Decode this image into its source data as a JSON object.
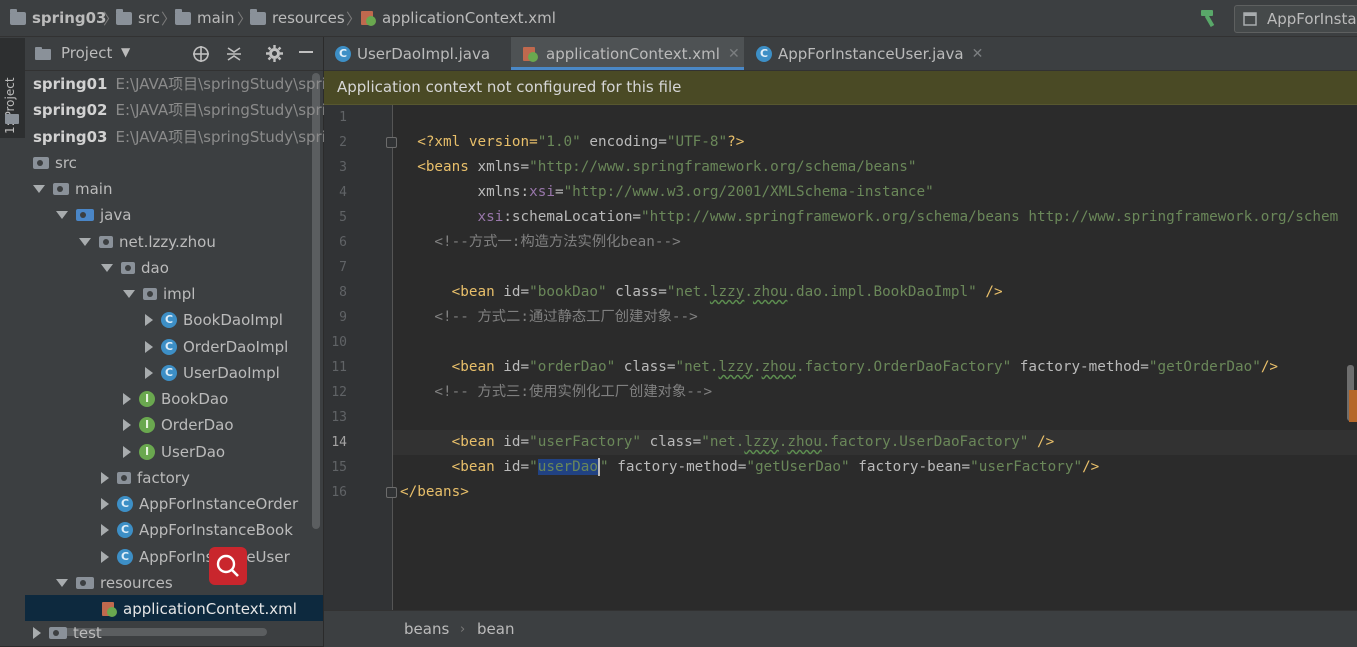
{
  "navbar": {
    "crumbs": [
      "spring03",
      "src",
      "main",
      "resources",
      "applicationContext.xml"
    ],
    "run_config": "AppForInsta"
  },
  "toolstrip": {
    "project_label": "1: Project"
  },
  "project_panel": {
    "title": "Project",
    "modules": [
      {
        "name": "spring01",
        "path": "E:\\JAVA项目\\springStudy\\sprir"
      },
      {
        "name": "spring02",
        "path": "E:\\JAVA项目\\springStudy\\sprir"
      },
      {
        "name": "spring03",
        "path": "E:\\JAVA项目\\springStudy\\sprir"
      }
    ],
    "tree": {
      "src": "src",
      "main": "main",
      "java": "java",
      "pkg": "net.lzzy.zhou",
      "dao": "dao",
      "impl": "impl",
      "book_impl": "BookDaoImpl",
      "order_impl": "OrderDaoImpl",
      "user_impl": "UserDaoImpl",
      "book_dao": "BookDao",
      "order_dao": "OrderDao",
      "user_dao": "UserDao",
      "factory": "factory",
      "app_order": "AppForInstanceOrder",
      "app_book": "AppForInstanceBook",
      "app_user": "AppForInstanceUser",
      "resources": "resources",
      "app_ctx": "applicationContext.xml",
      "test": "test"
    }
  },
  "tabs": [
    {
      "label": "UserDaoImpl.java"
    },
    {
      "label": "applicationContext.xml"
    },
    {
      "label": "AppForInstanceUser.java"
    }
  ],
  "banner": {
    "text": "Application context not configured for this file"
  },
  "editor": {
    "line_numbers": [
      "1",
      "2",
      "3",
      "4",
      "5",
      "6",
      "7",
      "8",
      "9",
      "10",
      "11",
      "12",
      "13",
      "14",
      "15",
      "16"
    ],
    "l1": {
      "a": "<?xml version=",
      "b": "\"1.0\"",
      "c": " encoding=",
      "d": "\"UTF-8\"",
      "e": "?>"
    },
    "l2": {
      "a": "<beans ",
      "b": "xmlns=",
      "c": "\"http://www.springframework.org/schema/beans\""
    },
    "l3": {
      "a": "       xmlns:",
      "b": "xsi",
      "c": "=",
      "d": "\"http://www.w3.org/2001/XMLSchema-instance\""
    },
    "l4": {
      "a": "       ",
      "b": "xsi",
      "c": ":schemaLocation=",
      "d": "\"http://www.springframework.org/schema/beans http://www.springframework.org/schem"
    },
    "l6": "    <!--方式一:构造方法实例化bean-->",
    "l7": {
      "a": "    <bean ",
      "b": "id=",
      "c": "\"bookDao\"",
      "d": " class=",
      "e1": "\"net.",
      "e2": "lzzy",
      "e3": ".",
      "e4": "zhou",
      "e5": ".dao.impl.BookDaoImpl\"",
      "f": " />"
    },
    "l9": "    <!-- 方式二:通过静态工厂创建对象-->",
    "l10": {
      "a": "    <bean ",
      "b": "id=",
      "c": "\"orderDao\"",
      "d": " class=",
      "e1": "\"net.",
      "e2": "lzzy",
      "e3": ".",
      "e4": "zhou",
      "e5": ".factory.OrderDaoFactory\"",
      "f": " factory-method=",
      "g": "\"getOrderDao\"",
      "h": "/>"
    },
    "l12": "    <!-- 方式三:使用实例化工厂创建对象-->",
    "l13": {
      "a": "    <bean ",
      "b": "id=",
      "c": "\"userFactory\"",
      "d": " class=",
      "e1": "\"net.",
      "e2": "lzzy",
      "e3": ".",
      "e4": "zhou",
      "e5": ".factory.UserDaoFactory\"",
      "f": " />"
    },
    "l14": {
      "a": "    <bean ",
      "b": "id=",
      "c": "\"",
      "d": "userDao",
      "e": "\"",
      "f": " factory-method=",
      "g": "\"getUserDao\"",
      "h": " factory-bean=",
      "i": "\"userFactory\"",
      "j": "/>"
    },
    "l16": "</beans>"
  },
  "footer": {
    "crumbs": [
      "beans",
      "bean"
    ]
  },
  "colors": {
    "tag": "#e8bf6a",
    "value": "#6a8759",
    "namespace": "#9876aa",
    "comment": "#808080",
    "accent": "#4a88c7",
    "banner": "#4a4a25"
  }
}
